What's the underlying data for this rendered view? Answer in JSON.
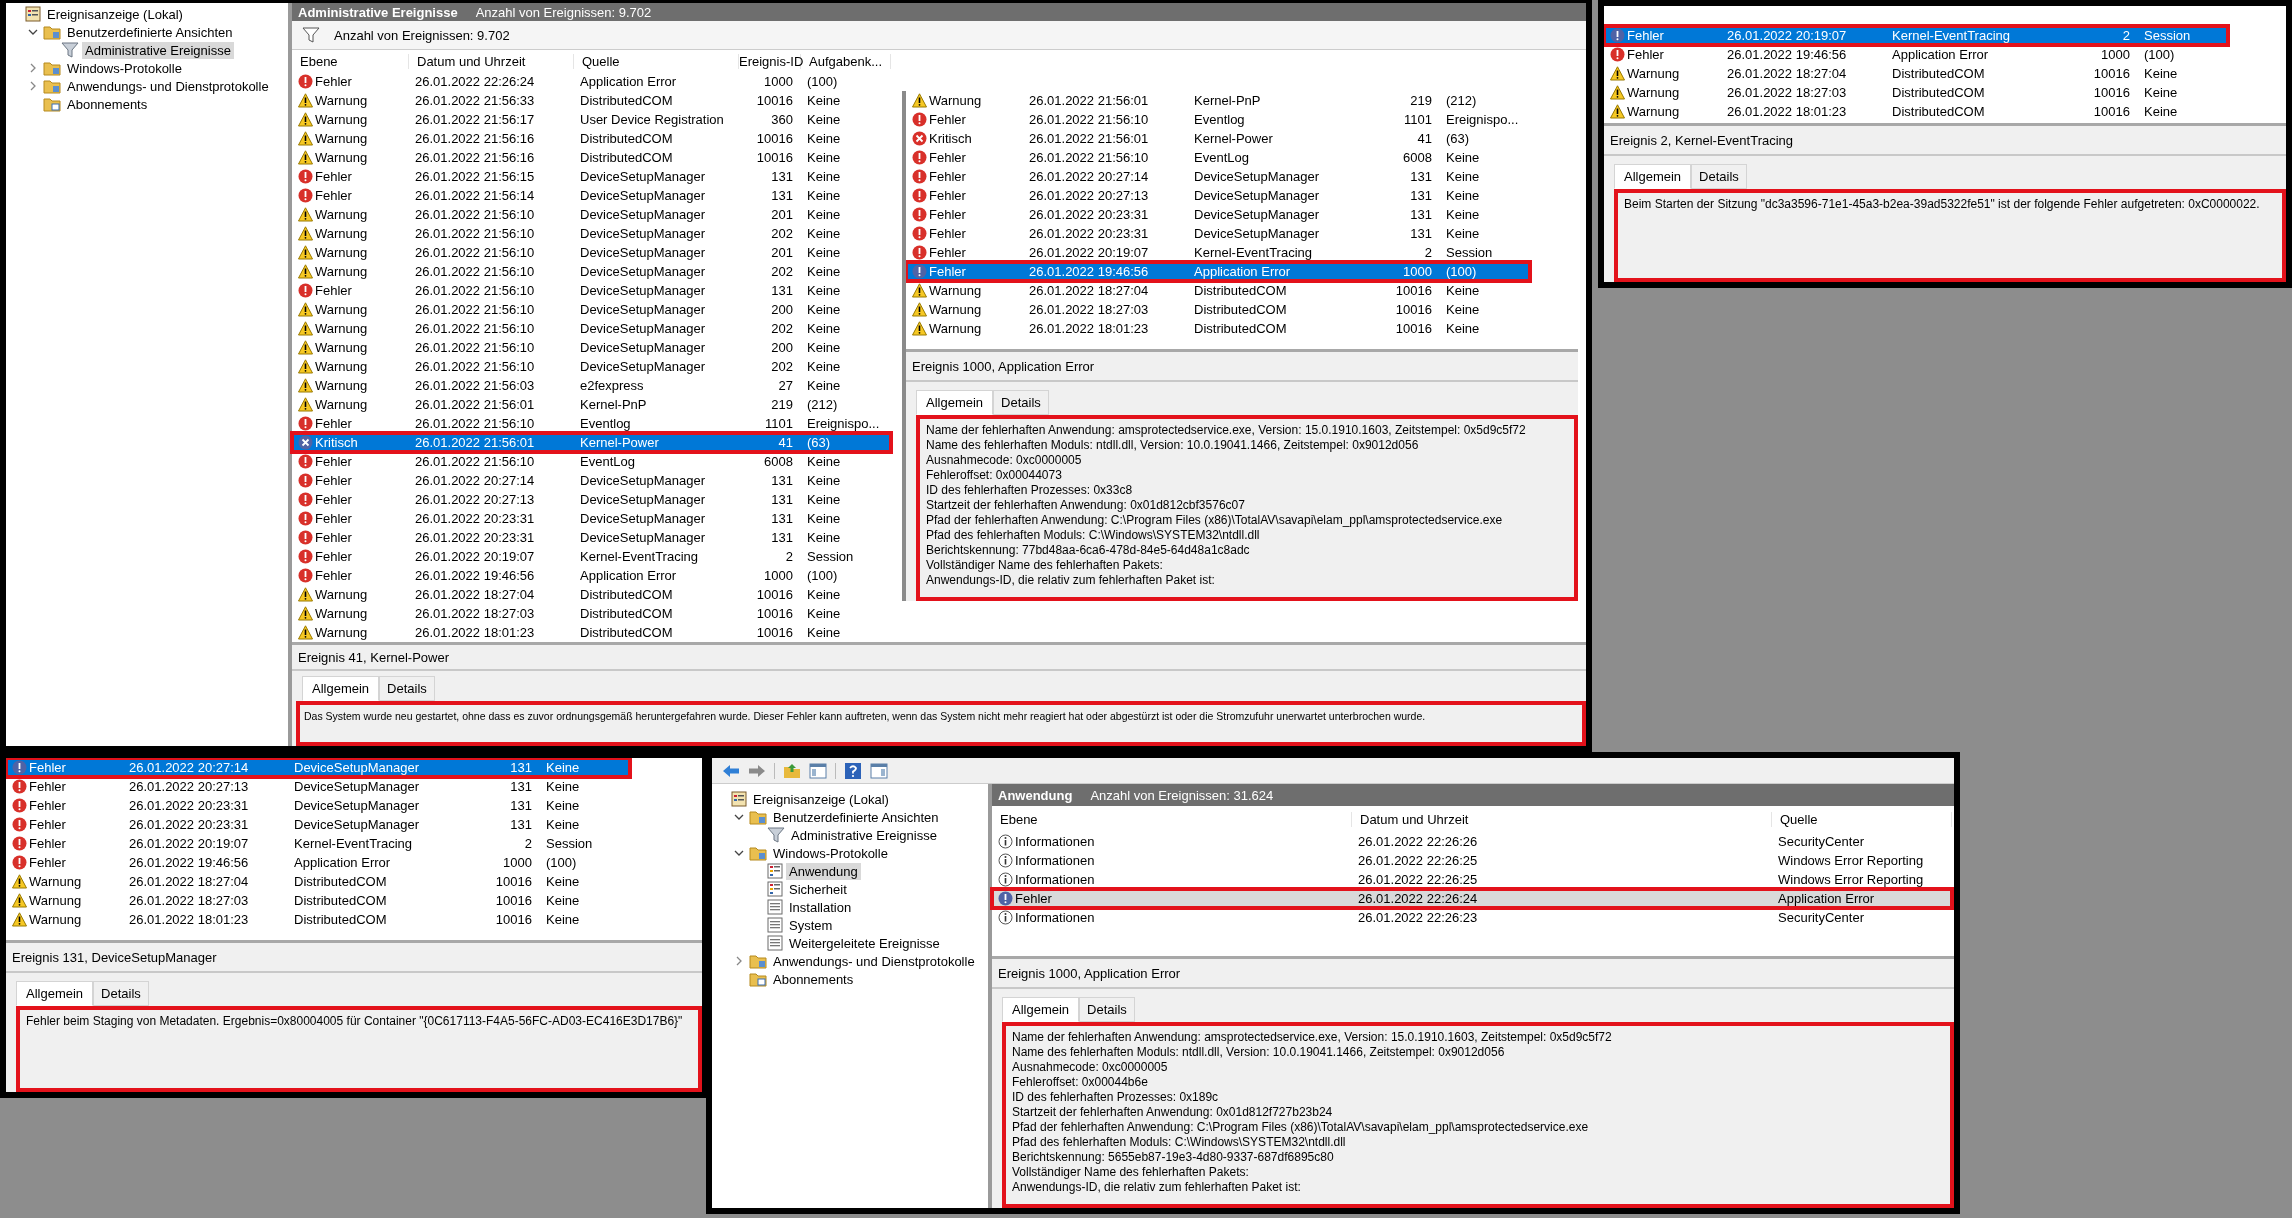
{
  "windows": [
    {
      "tree": [
        {
          "label": "Ereignisanzeige (Lokal)",
          "kind": "viewer",
          "selected": false,
          "children": [
            {
              "label": "Benutzerdefinierte Ansichten",
              "kind": "folder",
              "expanded": true,
              "selected": false,
              "children": [
                {
                  "label": "Administrative Ereignisse",
                  "kind": "filter",
                  "selected": true
                }
              ]
            },
            {
              "label": "Windows-Protokolle",
              "kind": "folder",
              "expanded": false,
              "selected": false
            },
            {
              "label": "Anwendungs- und Dienstprotokolle",
              "kind": "folder",
              "expanded": false,
              "selected": false
            },
            {
              "label": "Abonnements",
              "kind": "subs",
              "selected": false
            }
          ]
        }
      ],
      "header": {
        "title": "Administrative Ereignisse",
        "count": "Anzahl von Ereignissen: 9.702"
      },
      "filter_count": "Anzahl von Ereignissen: 9.702",
      "columns": [
        "Ebene",
        "Datum und Uhrzeit",
        "Quelle",
        "Ereignis-ID",
        "Aufgabenk..."
      ],
      "rows": [
        {
          "kind": "error",
          "cells": [
            "Fehler",
            "26.01.2022 22:26:24",
            "Application Error",
            "1000",
            "(100)"
          ],
          "selected": false,
          "highlighted": false
        },
        {
          "kind": "warning",
          "cells": [
            "Warnung",
            "26.01.2022 21:56:33",
            "DistributedCOM",
            "10016",
            "Keine"
          ],
          "selected": false,
          "highlighted": false
        },
        {
          "kind": "warning",
          "cells": [
            "Warnung",
            "26.01.2022 21:56:17",
            "User Device Registration",
            "360",
            "Keine"
          ],
          "selected": false,
          "highlighted": false
        },
        {
          "kind": "warning",
          "cells": [
            "Warnung",
            "26.01.2022 21:56:16",
            "DistributedCOM",
            "10016",
            "Keine"
          ],
          "selected": false,
          "highlighted": false
        },
        {
          "kind": "warning",
          "cells": [
            "Warnung",
            "26.01.2022 21:56:16",
            "DistributedCOM",
            "10016",
            "Keine"
          ],
          "selected": false,
          "highlighted": false
        },
        {
          "kind": "error",
          "cells": [
            "Fehler",
            "26.01.2022 21:56:15",
            "DeviceSetupManager",
            "131",
            "Keine"
          ],
          "selected": false,
          "highlighted": false
        },
        {
          "kind": "error",
          "cells": [
            "Fehler",
            "26.01.2022 21:56:14",
            "DeviceSetupManager",
            "131",
            "Keine"
          ],
          "selected": false,
          "highlighted": false
        },
        {
          "kind": "warning",
          "cells": [
            "Warnung",
            "26.01.2022 21:56:10",
            "DeviceSetupManager",
            "201",
            "Keine"
          ],
          "selected": false,
          "highlighted": false
        },
        {
          "kind": "warning",
          "cells": [
            "Warnung",
            "26.01.2022 21:56:10",
            "DeviceSetupManager",
            "202",
            "Keine"
          ],
          "selected": false,
          "highlighted": false
        },
        {
          "kind": "warning",
          "cells": [
            "Warnung",
            "26.01.2022 21:56:10",
            "DeviceSetupManager",
            "201",
            "Keine"
          ],
          "selected": false,
          "highlighted": false
        },
        {
          "kind": "warning",
          "cells": [
            "Warnung",
            "26.01.2022 21:56:10",
            "DeviceSetupManager",
            "202",
            "Keine"
          ],
          "selected": false,
          "highlighted": false
        },
        {
          "kind": "error",
          "cells": [
            "Fehler",
            "26.01.2022 21:56:10",
            "DeviceSetupManager",
            "131",
            "Keine"
          ],
          "selected": false,
          "highlighted": false
        },
        {
          "kind": "warning",
          "cells": [
            "Warnung",
            "26.01.2022 21:56:10",
            "DeviceSetupManager",
            "200",
            "Keine"
          ],
          "selected": false,
          "highlighted": false
        },
        {
          "kind": "warning",
          "cells": [
            "Warnung",
            "26.01.2022 21:56:10",
            "DeviceSetupManager",
            "202",
            "Keine"
          ],
          "selected": false,
          "highlighted": false
        },
        {
          "kind": "warning",
          "cells": [
            "Warnung",
            "26.01.2022 21:56:10",
            "DeviceSetupManager",
            "200",
            "Keine"
          ],
          "selected": false,
          "highlighted": false
        },
        {
          "kind": "warning",
          "cells": [
            "Warnung",
            "26.01.2022 21:56:10",
            "DeviceSetupManager",
            "202",
            "Keine"
          ],
          "selected": false,
          "highlighted": false
        },
        {
          "kind": "warning",
          "cells": [
            "Warnung",
            "26.01.2022 21:56:03",
            "e2fexpress",
            "27",
            "Keine"
          ],
          "selected": false,
          "highlighted": false
        },
        {
          "kind": "warning",
          "cells": [
            "Warnung",
            "26.01.2022 21:56:01",
            "Kernel-PnP",
            "219",
            "(212)"
          ],
          "selected": false,
          "highlighted": false
        },
        {
          "kind": "error",
          "cells": [
            "Fehler",
            "26.01.2022 21:56:10",
            "Eventlog",
            "1101",
            "Ereignispo..."
          ],
          "selected": false,
          "highlighted": false
        },
        {
          "kind": "critical",
          "cells": [
            "Kritisch",
            "26.01.2022 21:56:01",
            "Kernel-Power",
            "41",
            "(63)"
          ],
          "selected": true,
          "highlighted": true
        },
        {
          "kind": "error",
          "cells": [
            "Fehler",
            "26.01.2022 21:56:10",
            "EventLog",
            "6008",
            "Keine"
          ],
          "selected": false,
          "highlighted": false
        },
        {
          "kind": "error",
          "cells": [
            "Fehler",
            "26.01.2022 20:27:14",
            "DeviceSetupManager",
            "131",
            "Keine"
          ],
          "selected": false,
          "highlighted": false
        },
        {
          "kind": "error",
          "cells": [
            "Fehler",
            "26.01.2022 20:27:13",
            "DeviceSetupManager",
            "131",
            "Keine"
          ],
          "selected": false,
          "highlighted": false
        },
        {
          "kind": "error",
          "cells": [
            "Fehler",
            "26.01.2022 20:23:31",
            "DeviceSetupManager",
            "131",
            "Keine"
          ],
          "selected": false,
          "highlighted": false
        },
        {
          "kind": "error",
          "cells": [
            "Fehler",
            "26.01.2022 20:23:31",
            "DeviceSetupManager",
            "131",
            "Keine"
          ],
          "selected": false,
          "highlighted": false
        },
        {
          "kind": "error",
          "cells": [
            "Fehler",
            "26.01.2022 20:19:07",
            "Kernel-EventTracing",
            "2",
            "Session"
          ],
          "selected": false,
          "highlighted": false
        },
        {
          "kind": "error",
          "cells": [
            "Fehler",
            "26.01.2022 19:46:56",
            "Application Error",
            "1000",
            "(100)"
          ],
          "selected": false,
          "highlighted": false
        },
        {
          "kind": "warning",
          "cells": [
            "Warnung",
            "26.01.2022 18:27:04",
            "DistributedCOM",
            "10016",
            "Keine"
          ],
          "selected": false,
          "highlighted": false
        },
        {
          "kind": "warning",
          "cells": [
            "Warnung",
            "26.01.2022 18:27:03",
            "DistributedCOM",
            "10016",
            "Keine"
          ],
          "selected": false,
          "highlighted": false
        },
        {
          "kind": "warning",
          "cells": [
            "Warnung",
            "26.01.2022 18:01:23",
            "DistributedCOM",
            "10016",
            "Keine"
          ],
          "selected": false,
          "highlighted": false
        }
      ],
      "detail": {
        "title": "Ereignis 41, Kernel-Power",
        "tabs": [
          {
            "label": "Allgemein",
            "selected": true
          },
          {
            "label": "Details",
            "selected": false
          }
        ],
        "highlighted": true,
        "lines": [
          "Das System wurde neu gestartet, ohne dass es zuvor ordnungsgemäß heruntergefahren wurde. Dieser Fehler kann auftreten, wenn das System nicht mehr reagiert hat oder abgestürzt ist oder die Stromzufuhr unerwartet unterbrochen wurde."
        ]
      }
    },
    {
      "rows": [
        {
          "kind": "warning",
          "cells": [
            "Warnung",
            "26.01.2022 21:56:01",
            "Kernel-PnP",
            "219",
            "(212)"
          ],
          "selected": false,
          "highlighted": false
        },
        {
          "kind": "error",
          "cells": [
            "Fehler",
            "26.01.2022 21:56:10",
            "Eventlog",
            "1101",
            "Ereignispo..."
          ],
          "selected": false,
          "highlighted": false
        },
        {
          "kind": "critical",
          "cells": [
            "Kritisch",
            "26.01.2022 21:56:01",
            "Kernel-Power",
            "41",
            "(63)"
          ],
          "selected": false,
          "highlighted": false
        },
        {
          "kind": "error",
          "cells": [
            "Fehler",
            "26.01.2022 21:56:10",
            "EventLog",
            "6008",
            "Keine"
          ],
          "selected": false,
          "highlighted": false
        },
        {
          "kind": "error",
          "cells": [
            "Fehler",
            "26.01.2022 20:27:14",
            "DeviceSetupManager",
            "131",
            "Keine"
          ],
          "selected": false,
          "highlighted": false
        },
        {
          "kind": "error",
          "cells": [
            "Fehler",
            "26.01.2022 20:27:13",
            "DeviceSetupManager",
            "131",
            "Keine"
          ],
          "selected": false,
          "highlighted": false
        },
        {
          "kind": "error",
          "cells": [
            "Fehler",
            "26.01.2022 20:23:31",
            "DeviceSetupManager",
            "131",
            "Keine"
          ],
          "selected": false,
          "highlighted": false
        },
        {
          "kind": "error",
          "cells": [
            "Fehler",
            "26.01.2022 20:23:31",
            "DeviceSetupManager",
            "131",
            "Keine"
          ],
          "selected": false,
          "highlighted": false
        },
        {
          "kind": "error",
          "cells": [
            "Fehler",
            "26.01.2022 20:19:07",
            "Kernel-EventTracing",
            "2",
            "Session"
          ],
          "selected": false,
          "highlighted": false
        },
        {
          "kind": "error",
          "cells": [
            "Fehler",
            "26.01.2022 19:46:56",
            "Application Error",
            "1000",
            "(100)"
          ],
          "selected": true,
          "highlighted": true
        },
        {
          "kind": "warning",
          "cells": [
            "Warnung",
            "26.01.2022 18:27:04",
            "DistributedCOM",
            "10016",
            "Keine"
          ],
          "selected": false,
          "highlighted": false
        },
        {
          "kind": "warning",
          "cells": [
            "Warnung",
            "26.01.2022 18:27:03",
            "DistributedCOM",
            "10016",
            "Keine"
          ],
          "selected": false,
          "highlighted": false
        },
        {
          "kind": "warning",
          "cells": [
            "Warnung",
            "26.01.2022 18:01:23",
            "DistributedCOM",
            "10016",
            "Keine"
          ],
          "selected": false,
          "highlighted": false
        }
      ],
      "detail": {
        "title": "Ereignis 1000, Application Error",
        "tabs": [
          {
            "label": "Allgemein",
            "selected": true
          },
          {
            "label": "Details",
            "selected": false
          }
        ],
        "highlighted": true,
        "lines": [
          "Name der fehlerhaften Anwendung: amsprotectedservice.exe, Version: 15.0.1910.1603, Zeitstempel: 0x5d9c5f72",
          "Name des fehlerhaften Moduls: ntdll.dll, Version: 10.0.19041.1466, Zeitstempel: 0x9012d056",
          "Ausnahmecode: 0xc0000005",
          "Fehleroffset: 0x00044073",
          "ID des fehlerhaften Prozesses: 0x33c8",
          "Startzeit der fehlerhaften Anwendung: 0x01d812cbf3576c07",
          "Pfad der fehlerhaften Anwendung: C:\\Program Files (x86)\\TotalAV\\savapi\\elam_ppl\\amsprotectedservice.exe",
          "Pfad des fehlerhaften Moduls: C:\\Windows\\SYSTEM32\\ntdll.dll",
          "Berichtskennung: 77bd48aa-6ca6-478d-84e5-64d48a1c8adc",
          "Vollständiger Name des fehlerhaften Pakets:",
          "Anwendungs-ID, die relativ zum fehlerhaften Paket ist:"
        ]
      }
    },
    {
      "rows": [
        {
          "kind": "error",
          "cells": [
            "Fehler",
            "26.01.2022 20:19:07",
            "Kernel-EventTracing",
            "2",
            "Session"
          ],
          "selected": true,
          "highlighted": true
        },
        {
          "kind": "error",
          "cells": [
            "Fehler",
            "26.01.2022 19:46:56",
            "Application Error",
            "1000",
            "(100)"
          ],
          "selected": false,
          "highlighted": false
        },
        {
          "kind": "warning",
          "cells": [
            "Warnung",
            "26.01.2022 18:27:04",
            "DistributedCOM",
            "10016",
            "Keine"
          ],
          "selected": false,
          "highlighted": false
        },
        {
          "kind": "warning",
          "cells": [
            "Warnung",
            "26.01.2022 18:27:03",
            "DistributedCOM",
            "10016",
            "Keine"
          ],
          "selected": false,
          "highlighted": false
        },
        {
          "kind": "warning",
          "cells": [
            "Warnung",
            "26.01.2022 18:01:23",
            "DistributedCOM",
            "10016",
            "Keine"
          ],
          "selected": false,
          "highlighted": false
        }
      ],
      "detail": {
        "title": "Ereignis 2, Kernel-EventTracing",
        "tabs": [
          {
            "label": "Allgemein",
            "selected": true
          },
          {
            "label": "Details",
            "selected": false
          }
        ],
        "highlighted": true,
        "lines": [
          "Beim Starten der Sitzung \"dc3a3596-71e1-45a3-b2ea-39ad5322fe51\" ist der folgende Fehler aufgetreten: 0xC0000022."
        ]
      }
    },
    {
      "rows": [
        {
          "kind": "error",
          "cells": [
            "Fehler",
            "26.01.2022 20:27:14",
            "DeviceSetupManager",
            "131",
            "Keine"
          ],
          "selected": true,
          "highlighted": true
        },
        {
          "kind": "error",
          "cells": [
            "Fehler",
            "26.01.2022 20:27:13",
            "DeviceSetupManager",
            "131",
            "Keine"
          ],
          "selected": false,
          "highlighted": false
        },
        {
          "kind": "error",
          "cells": [
            "Fehler",
            "26.01.2022 20:23:31",
            "DeviceSetupManager",
            "131",
            "Keine"
          ],
          "selected": false,
          "highlighted": false
        },
        {
          "kind": "error",
          "cells": [
            "Fehler",
            "26.01.2022 20:23:31",
            "DeviceSetupManager",
            "131",
            "Keine"
          ],
          "selected": false,
          "highlighted": false
        },
        {
          "kind": "error",
          "cells": [
            "Fehler",
            "26.01.2022 20:19:07",
            "Kernel-EventTracing",
            "2",
            "Session"
          ],
          "selected": false,
          "highlighted": false
        },
        {
          "kind": "error",
          "cells": [
            "Fehler",
            "26.01.2022 19:46:56",
            "Application Error",
            "1000",
            "(100)"
          ],
          "selected": false,
          "highlighted": false
        },
        {
          "kind": "warning",
          "cells": [
            "Warnung",
            "26.01.2022 18:27:04",
            "DistributedCOM",
            "10016",
            "Keine"
          ],
          "selected": false,
          "highlighted": false
        },
        {
          "kind": "warning",
          "cells": [
            "Warnung",
            "26.01.2022 18:27:03",
            "DistributedCOM",
            "10016",
            "Keine"
          ],
          "selected": false,
          "highlighted": false
        },
        {
          "kind": "warning",
          "cells": [
            "Warnung",
            "26.01.2022 18:01:23",
            "DistributedCOM",
            "10016",
            "Keine"
          ],
          "selected": false,
          "highlighted": false
        }
      ],
      "detail": {
        "title": "Ereignis 131, DeviceSetupManager",
        "tabs": [
          {
            "label": "Allgemein",
            "selected": true
          },
          {
            "label": "Details",
            "selected": false
          }
        ],
        "highlighted": true,
        "lines": [
          "Fehler beim Staging von Metadaten. Ergebnis=0x80004005 für Container \"{0C617113-F4A5-56FC-AD03-EC416E3D17B6}\""
        ]
      }
    },
    {
      "toolbar": true,
      "tree": [
        {
          "label": "Ereignisanzeige (Lokal)",
          "kind": "viewer",
          "selected": false,
          "children": [
            {
              "label": "Benutzerdefinierte Ansichten",
              "kind": "folder",
              "expanded": true,
              "selected": false,
              "children": [
                {
                  "label": "Administrative Ereignisse",
                  "kind": "filter",
                  "selected": false
                }
              ]
            },
            {
              "label": "Windows-Protokolle",
              "kind": "folder",
              "expanded": true,
              "selected": false,
              "children": [
                {
                  "label": "Anwendung",
                  "kind": "log",
                  "selected": true
                },
                {
                  "label": "Sicherheit",
                  "kind": "log",
                  "selected": false
                },
                {
                  "label": "Installation",
                  "kind": "plain",
                  "selected": false
                },
                {
                  "label": "System",
                  "kind": "plain",
                  "selected": false
                },
                {
                  "label": "Weitergeleitete Ereignisse",
                  "kind": "plain",
                  "selected": false
                }
              ]
            },
            {
              "label": "Anwendungs- und Dienstprotokolle",
              "kind": "folder",
              "expanded": false,
              "selected": false
            },
            {
              "label": "Abonnements",
              "kind": "subs",
              "selected": false
            }
          ]
        }
      ],
      "header": {
        "title": "Anwendung",
        "count": "Anzahl von Ereignissen: 31.624"
      },
      "columns": [
        "Ebene",
        "Datum und Uhrzeit",
        "Quelle"
      ],
      "rows": [
        {
          "kind": "info",
          "cells": [
            "Informationen",
            "26.01.2022 22:26:26",
            "SecurityCenter"
          ],
          "selected": false,
          "highlighted": false
        },
        {
          "kind": "info",
          "cells": [
            "Informationen",
            "26.01.2022 22:26:25",
            "Windows Error Reporting"
          ],
          "selected": false,
          "highlighted": false
        },
        {
          "kind": "info",
          "cells": [
            "Informationen",
            "26.01.2022 22:26:25",
            "Windows Error Reporting"
          ],
          "selected": false,
          "highlighted": false
        },
        {
          "kind": "error",
          "cells": [
            "Fehler",
            "26.01.2022 22:26:24",
            "Application Error"
          ],
          "selected": true,
          "highlighted": true
        },
        {
          "kind": "info",
          "cells": [
            "Informationen",
            "26.01.2022 22:26:23",
            "SecurityCenter"
          ],
          "selected": false,
          "highlighted": false
        }
      ],
      "detail": {
        "title": "Ereignis 1000, Application Error",
        "tabs": [
          {
            "label": "Allgemein",
            "selected": true
          },
          {
            "label": "Details",
            "selected": false
          }
        ],
        "highlighted": true,
        "lines": [
          "Name der fehlerhaften Anwendung: amsprotectedservice.exe, Version: 15.0.1910.1603, Zeitstempel: 0x5d9c5f72",
          "Name des fehlerhaften Moduls: ntdll.dll, Version: 10.0.19041.1466, Zeitstempel: 0x9012d056",
          "Ausnahmecode: 0xc0000005",
          "Fehleroffset: 0x00044b6e",
          "ID des fehlerhaften Prozesses: 0x189c",
          "Startzeit der fehlerhaften Anwendung: 0x01d812f727b23b24",
          "Pfad der fehlerhaften Anwendung: C:\\Program Files (x86)\\TotalAV\\savapi\\elam_ppl\\amsprotectedservice.exe",
          "Pfad des fehlerhaften Moduls: C:\\Windows\\SYSTEM32\\ntdll.dll",
          "Berichtskennung: 5655eb87-19e3-4d80-9337-687df6895c80",
          "Vollständiger Name des fehlerhaften Pakets:",
          "Anwendungs-ID, die relativ zum fehlerhaften Paket ist:"
        ]
      }
    }
  ]
}
